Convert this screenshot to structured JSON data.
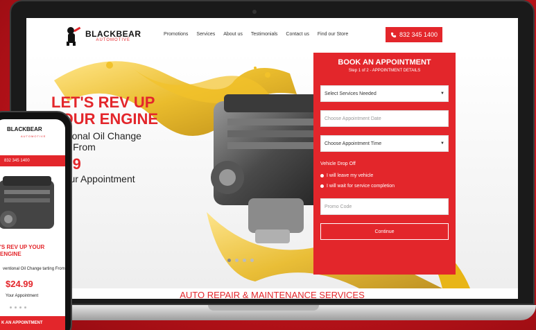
{
  "brand": {
    "name": "BLACKBEAR",
    "tagline": "AUTOMOTIVE"
  },
  "nav": [
    "Promotions",
    "Services",
    "About us",
    "Testimonials",
    "Contact us",
    "Find our Store"
  ],
  "header": {
    "phone": "832 345 1400"
  },
  "hero": {
    "headline": "LET'S REV UP YOUR ENGINE",
    "subline_1": "ventional Oil Change",
    "subline_2": "rting From",
    "price": "4.99",
    "cta": "k Your Appointment"
  },
  "booking": {
    "title": "BOOK AN APPOINTMENT",
    "step": "Step 1 of 2 - APPOINTMENT DETAILS",
    "services_select": "Select Services Needed",
    "date_placeholder": "Choose Appointment Date",
    "time_select": "Choose Appointment Time",
    "dropoff_label": "Vehicle Drop Off",
    "option_leave": "I will leave my vehicle",
    "option_wait": "I will wait for service completion",
    "promo_placeholder": "Promo Code",
    "continue_label": "Continue"
  },
  "section_title": "AUTO REPAIR & MAINTENANCE SERVICES",
  "phone_view": {
    "logo": "BLACKBEAR",
    "logo_sub": "AUTOMOTIVE",
    "phone": "832 345 1400",
    "headline": "'S REV UP YOUR ENGINE",
    "subline": "ventional Oil Change tarting From",
    "price": "$24.99",
    "cta": "Your Appointment",
    "book_title": "K AN APPOINTMENT"
  },
  "colors": {
    "accent": "#e3262b",
    "background": "#c0141b"
  }
}
